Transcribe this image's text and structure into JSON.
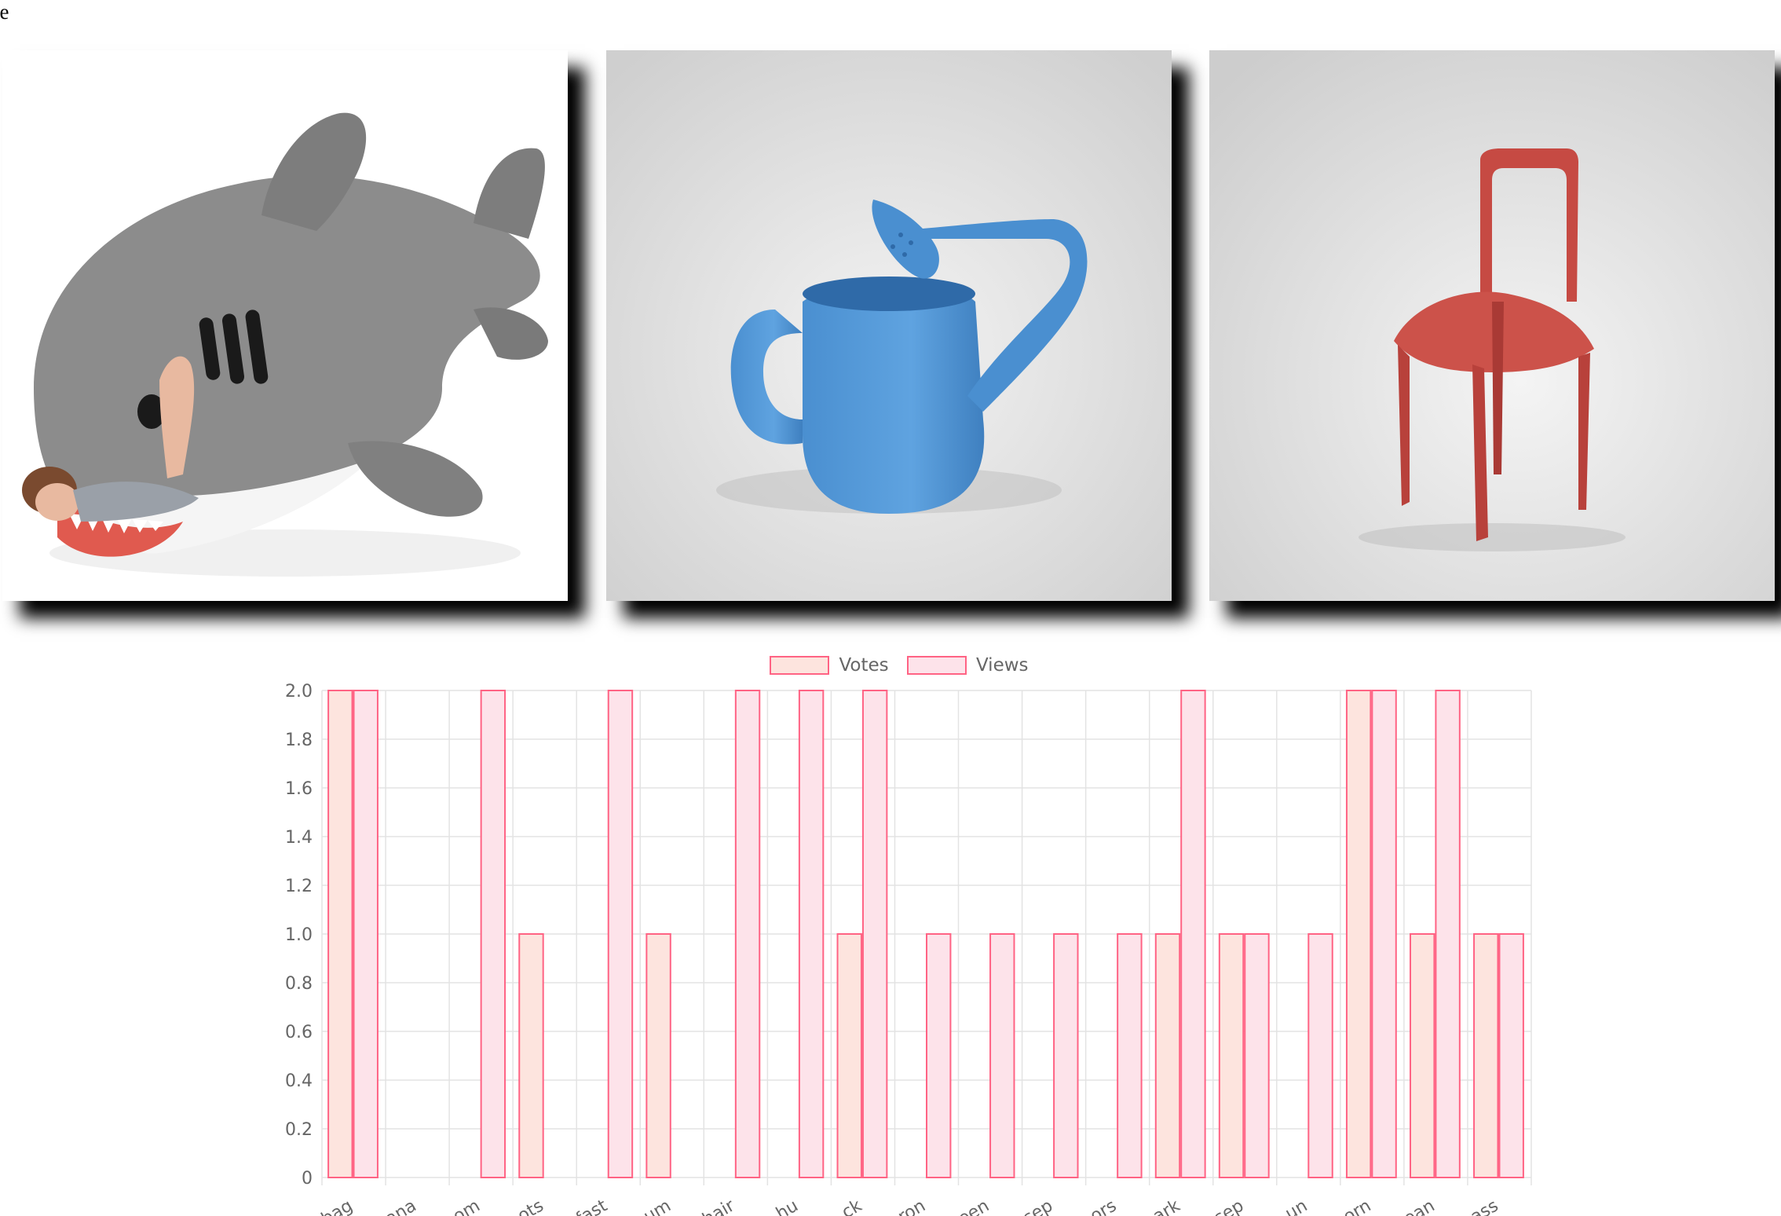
{
  "page": {
    "header_text": "ge"
  },
  "gallery": {
    "items": [
      {
        "name": "shark-sleeping-bag-image"
      },
      {
        "name": "watering-can-image"
      },
      {
        "name": "red-chair-image"
      }
    ]
  },
  "colors": {
    "votes_fill": "#fde4de",
    "views_fill": "#fde3ea",
    "bar_border": "#ff6384",
    "grid": "#e3e3e3",
    "tick_text": "#666666"
  },
  "chart_data": {
    "type": "bar",
    "legend": [
      "Votes",
      "Views"
    ],
    "legend_position": "top",
    "grid": true,
    "ylim": [
      0,
      2.0
    ],
    "yticks": [
      "0",
      "0.2",
      "0.4",
      "0.6",
      "0.8",
      "1.0",
      "1.2",
      "1.4",
      "1.6",
      "1.8",
      "2.0"
    ],
    "categories": [
      "bag",
      "ana",
      "om",
      "ots",
      "fast",
      "um",
      "hair",
      "hu",
      "ck",
      "ron",
      "een",
      "sep",
      "ors",
      "ark",
      "sep",
      "un",
      "orn",
      "ean",
      "ass"
    ],
    "series": [
      {
        "name": "Votes",
        "values": [
          2,
          0,
          0,
          1,
          0,
          1,
          0,
          0,
          1,
          0,
          0,
          0,
          0,
          1,
          1,
          0,
          2,
          1,
          1
        ]
      },
      {
        "name": "Views",
        "values": [
          2,
          0,
          2,
          0,
          2,
          0,
          2,
          2,
          2,
          1,
          1,
          1,
          1,
          2,
          1,
          1,
          2,
          2,
          1
        ]
      }
    ]
  }
}
